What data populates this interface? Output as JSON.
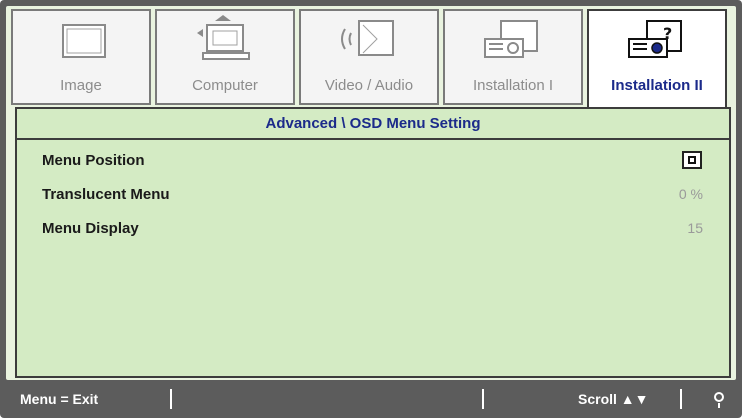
{
  "tabs": [
    {
      "label": "Image",
      "icon": "monitor-icon",
      "active": false
    },
    {
      "label": "Computer",
      "icon": "computer-icon",
      "active": false
    },
    {
      "label": "Video / Audio",
      "icon": "video-audio-icon",
      "active": false
    },
    {
      "label": "Installation I",
      "icon": "projector-icon",
      "active": false
    },
    {
      "label": "Installation II",
      "icon": "projector-help-icon",
      "active": true
    }
  ],
  "header": {
    "title": "Advanced \\ OSD Menu Setting"
  },
  "rows": [
    {
      "label": "Menu Position",
      "value": "",
      "value_icon": "menu-position-icon"
    },
    {
      "label": "Translucent Menu",
      "value": "0 %"
    },
    {
      "label": "Menu Display",
      "value": "15"
    }
  ],
  "footer": {
    "exit": "Menu = Exit",
    "scroll": "Scroll ▲▼",
    "hint_icon": "bulb-icon"
  },
  "colors": {
    "frame": "#5c5c5c",
    "panel": "#d4ebc4",
    "active_text": "#1b2a8a",
    "inactive_text": "#8c8c8c"
  }
}
